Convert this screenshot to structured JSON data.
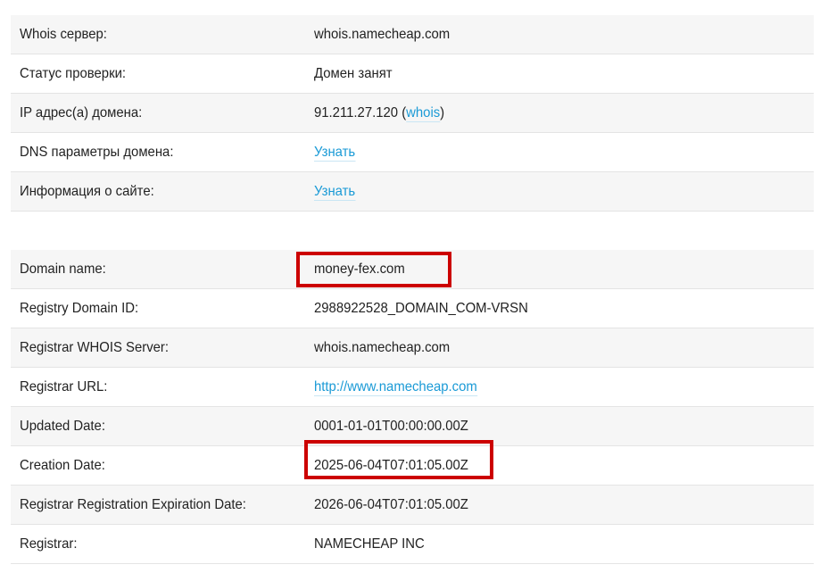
{
  "main_rows": [
    {
      "label": "Whois сервер:",
      "value": "whois.namecheap.com"
    },
    {
      "label": "Статус проверки:",
      "value": "Домен занят"
    },
    {
      "label": "IP адрес(а) домена:",
      "value_prefix": "91.211.27.120 (",
      "value_link": "whois",
      "value_suffix": ")"
    },
    {
      "label": "DNS параметры домена:",
      "value_link": "Узнать"
    },
    {
      "label": "Информация о сайте:",
      "value_link": "Узнать"
    }
  ],
  "registry_rows": [
    {
      "label": "Domain name:",
      "value": "money-fex.com"
    },
    {
      "label": "Registry Domain ID:",
      "value": "2988922528_DOMAIN_COM-VRSN"
    },
    {
      "label": "Registrar WHOIS Server:",
      "value": "whois.namecheap.com"
    },
    {
      "label": "Registrar URL:",
      "value_link": "http://www.namecheap.com"
    },
    {
      "label": "Updated Date:",
      "value": "0001-01-01T00:00:00.00Z"
    },
    {
      "label": "Creation Date:",
      "value": "2025-06-04T07:01:05.00Z"
    },
    {
      "label": "Registrar Registration Expiration Date:",
      "value": "2026-06-04T07:01:05.00Z"
    },
    {
      "label": "Registrar:",
      "value": "NAMECHEAP INC"
    }
  ],
  "colors": {
    "link": "#1a9ad6",
    "highlight_box": "#cc0000",
    "row_stripe": "#f6f6f6",
    "row_border": "#e4e4e4"
  }
}
